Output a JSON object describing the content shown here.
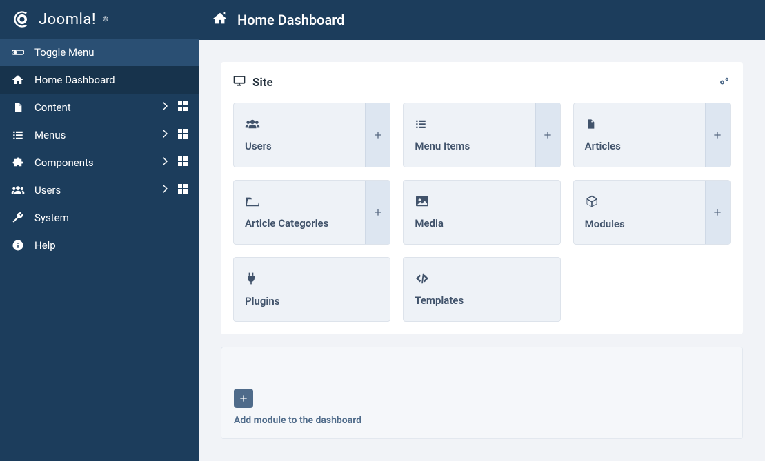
{
  "logo_text": "Joomla!",
  "sidebar": {
    "toggle": "Toggle Menu",
    "items": [
      {
        "label": "Home Dashboard",
        "icon": "home",
        "active": true,
        "has_sub": false
      },
      {
        "label": "Content",
        "icon": "file",
        "has_sub": true
      },
      {
        "label": "Menus",
        "icon": "list",
        "has_sub": true
      },
      {
        "label": "Components",
        "icon": "puzzle",
        "has_sub": true
      },
      {
        "label": "Users",
        "icon": "users",
        "has_sub": true
      },
      {
        "label": "System",
        "icon": "wrench",
        "has_sub": false
      },
      {
        "label": "Help",
        "icon": "info",
        "has_sub": false
      }
    ]
  },
  "topbar": {
    "title": "Home Dashboard"
  },
  "site_card": {
    "title": "Site",
    "tiles": [
      {
        "label": "Users",
        "icon": "users",
        "has_add": true
      },
      {
        "label": "Menu Items",
        "icon": "list",
        "has_add": true
      },
      {
        "label": "Articles",
        "icon": "file",
        "has_add": true
      },
      {
        "label": "Article Categories",
        "icon": "folder",
        "has_add": true
      },
      {
        "label": "Media",
        "icon": "image",
        "has_add": false
      },
      {
        "label": "Modules",
        "icon": "cube",
        "has_add": true
      },
      {
        "label": "Plugins",
        "icon": "plug",
        "has_add": false
      },
      {
        "label": "Templates",
        "icon": "code",
        "has_add": false
      }
    ]
  },
  "add_module": {
    "label": "Add module to the dashboard"
  }
}
